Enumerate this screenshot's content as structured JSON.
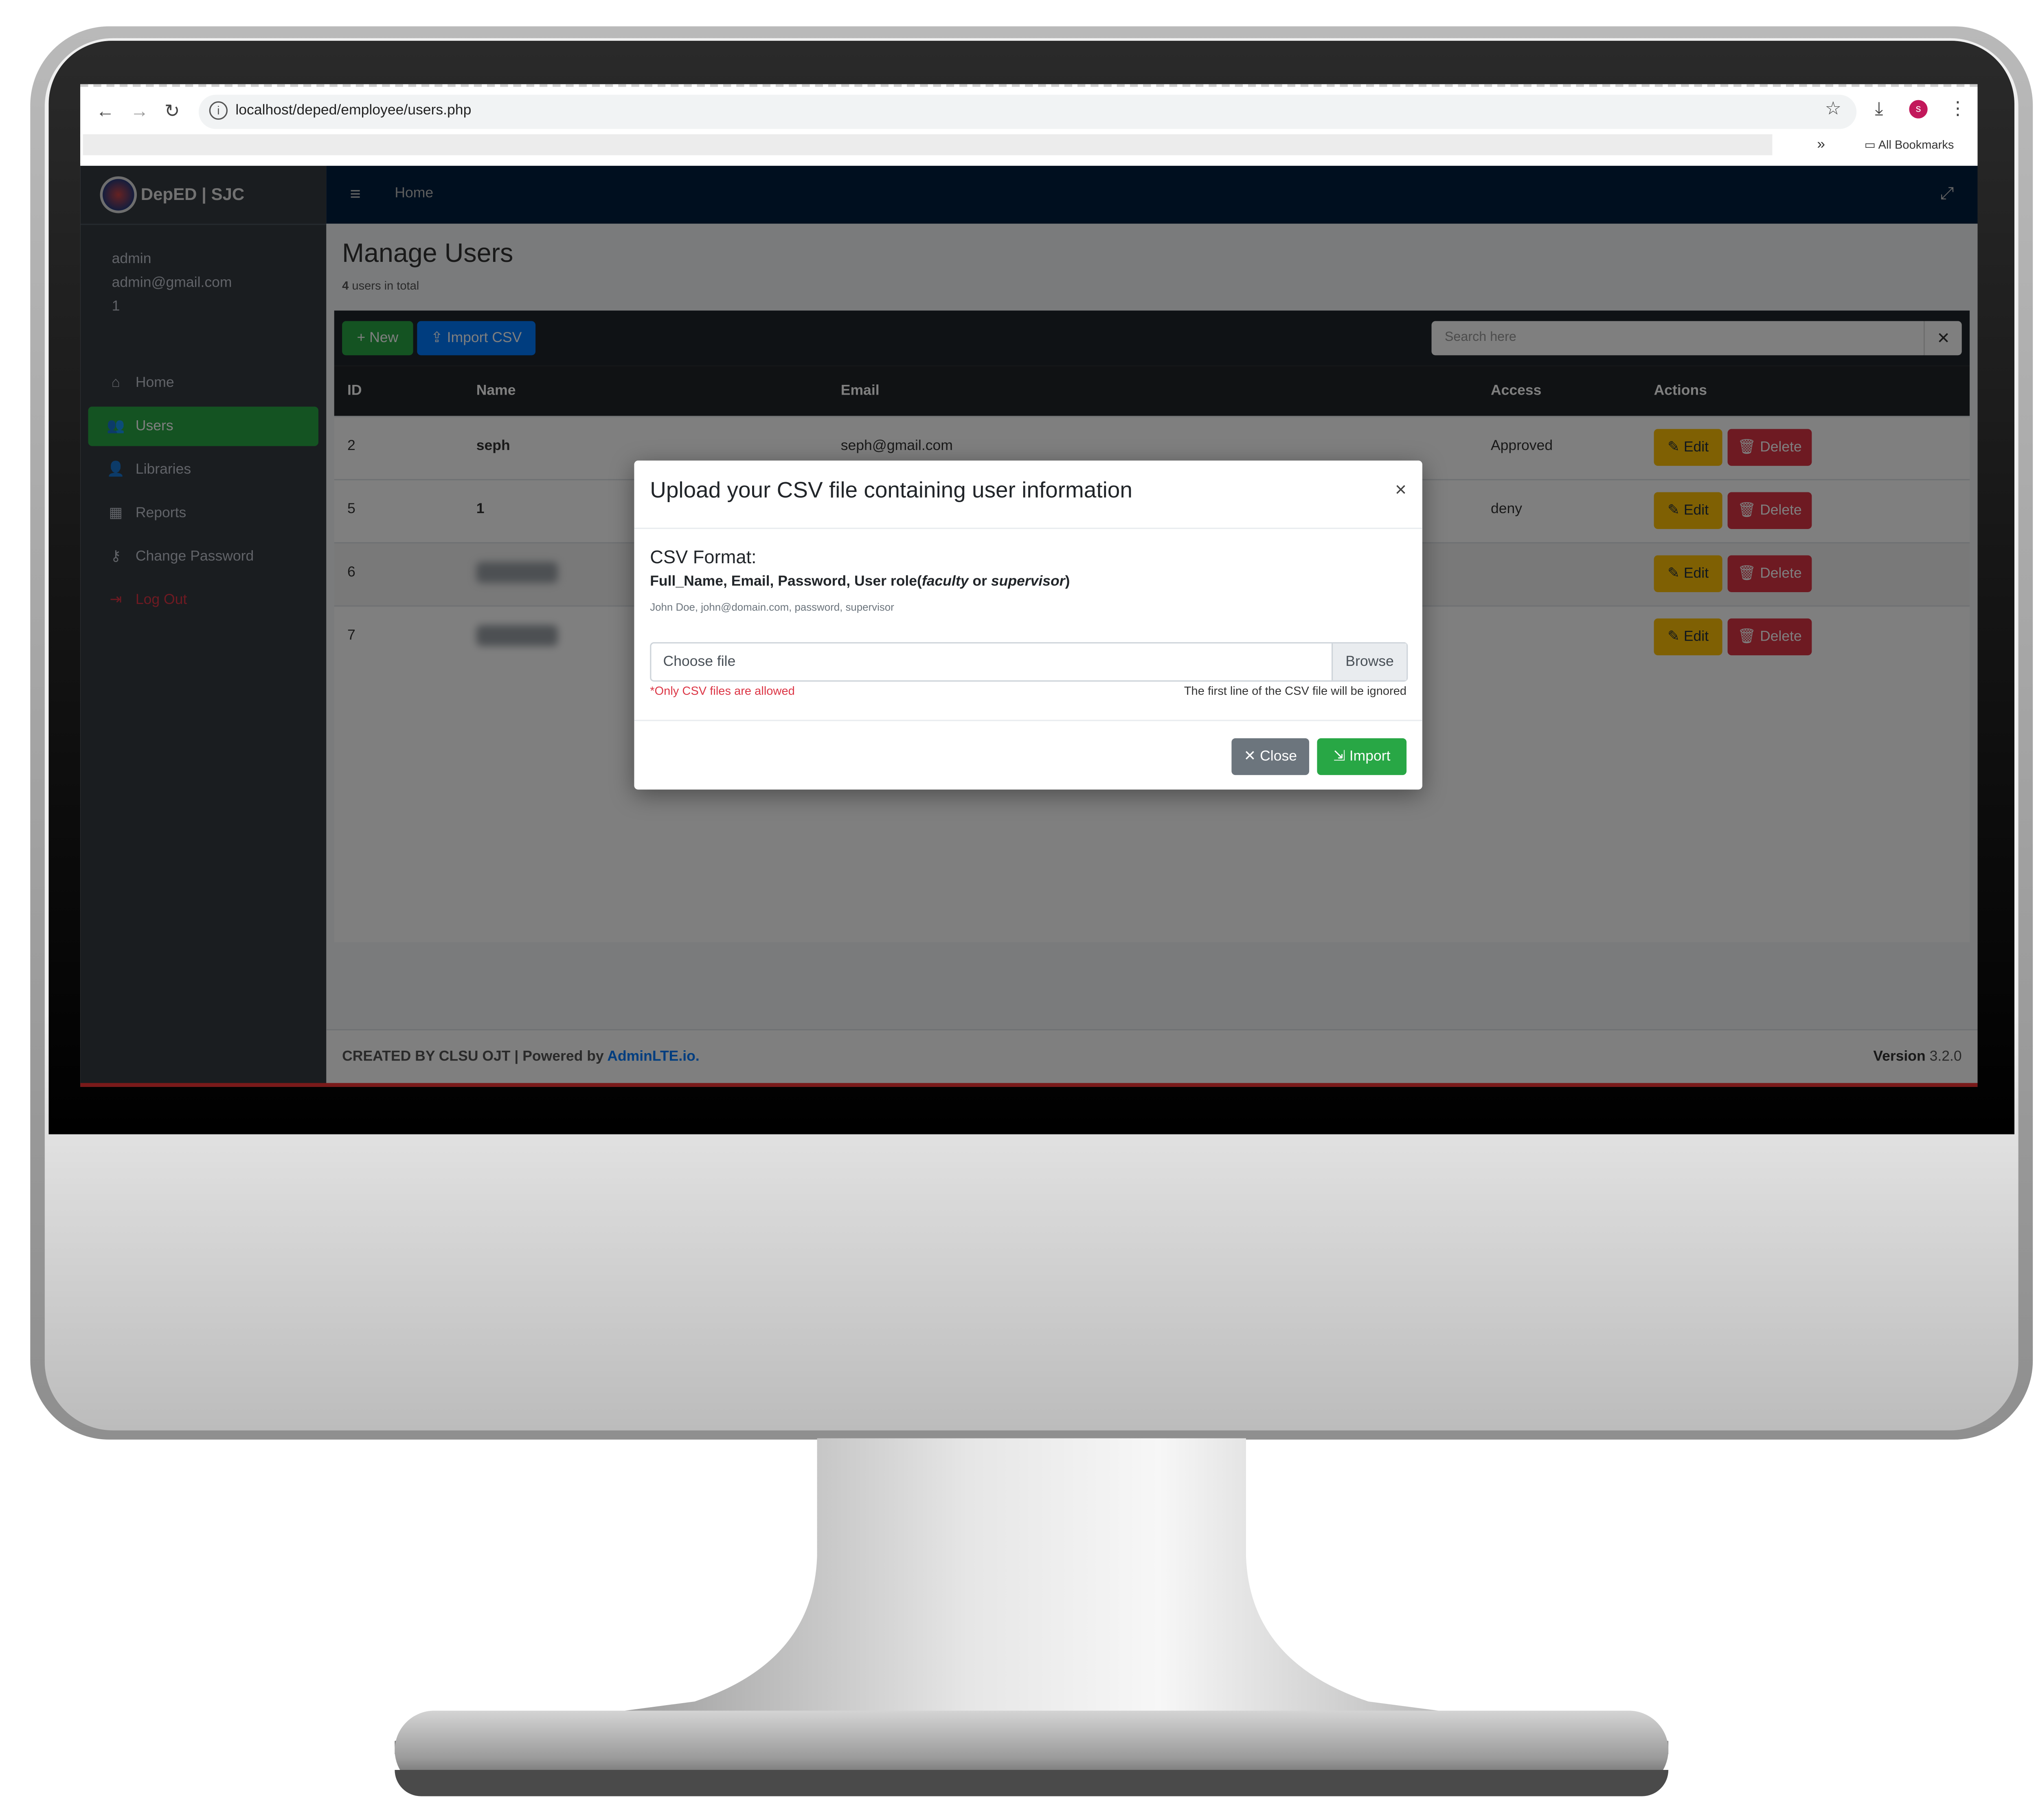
{
  "browser": {
    "url": "localhost/deped/employee/users.php",
    "bookmarks_more": "»",
    "all_bookmarks": "All Bookmarks",
    "profile_initial": "s"
  },
  "sidebar": {
    "brand": "DepED | SJC",
    "user": {
      "name": "admin",
      "email": "admin@gmail.com",
      "id": "1"
    },
    "items": [
      {
        "label": "Home",
        "icon": "home-icon"
      },
      {
        "label": "Users",
        "icon": "users-icon"
      },
      {
        "label": "Libraries",
        "icon": "user-plus-icon"
      },
      {
        "label": "Reports",
        "icon": "calendar-icon"
      },
      {
        "label": "Change Password",
        "icon": "key-icon"
      },
      {
        "label": "Log Out",
        "icon": "logout-icon"
      }
    ]
  },
  "topnav": {
    "home": "Home"
  },
  "page": {
    "title": "Manage Users",
    "count": "4",
    "count_suffix": " users in total"
  },
  "toolbar": {
    "new_label": "New",
    "import_label": "Import CSV",
    "search_placeholder": "Search here"
  },
  "table": {
    "headers": {
      "id": "ID",
      "name": "Name",
      "email": "Email",
      "access": "Access",
      "actions": "Actions"
    },
    "rows": [
      {
        "id": "2",
        "name": "seph",
        "email": "seph@gmail.com",
        "access": "Approved"
      },
      {
        "id": "5",
        "name": "1",
        "email": "",
        "access": "deny"
      },
      {
        "id": "6",
        "name": "",
        "email": "",
        "access": ""
      },
      {
        "id": "7",
        "name": "",
        "email": "",
        "access": ""
      }
    ],
    "edit_label": "Edit",
    "delete_label": "Delete"
  },
  "footer": {
    "credit": "CREATED BY CLSU OJT | Powered by ",
    "credit_link": "AdminLTE.io.",
    "version_label": "Version",
    "version": " 3.2.0"
  },
  "modal": {
    "title": "Upload your CSV file containing user information",
    "format_heading": "CSV Format:",
    "columns_prefix": "Full_Name, Email, Password, User role(",
    "role_a": "faculty",
    "or": " or ",
    "role_b": "supervisor",
    "columns_suffix": ")",
    "example": "John Doe, john@domain.com, password, supervisor",
    "file_placeholder": "Choose file",
    "browse": "Browse",
    "only_csv": "*Only CSV files are allowed",
    "first_line_note": "The first line of the CSV file will be ignored",
    "close_label": "Close",
    "import_label": "Import"
  },
  "colors": {
    "navy": "#001f3f",
    "sidebar": "#343a40",
    "success": "#28a745",
    "primary": "#007bff",
    "warning": "#ffc107",
    "danger": "#dc3545"
  }
}
